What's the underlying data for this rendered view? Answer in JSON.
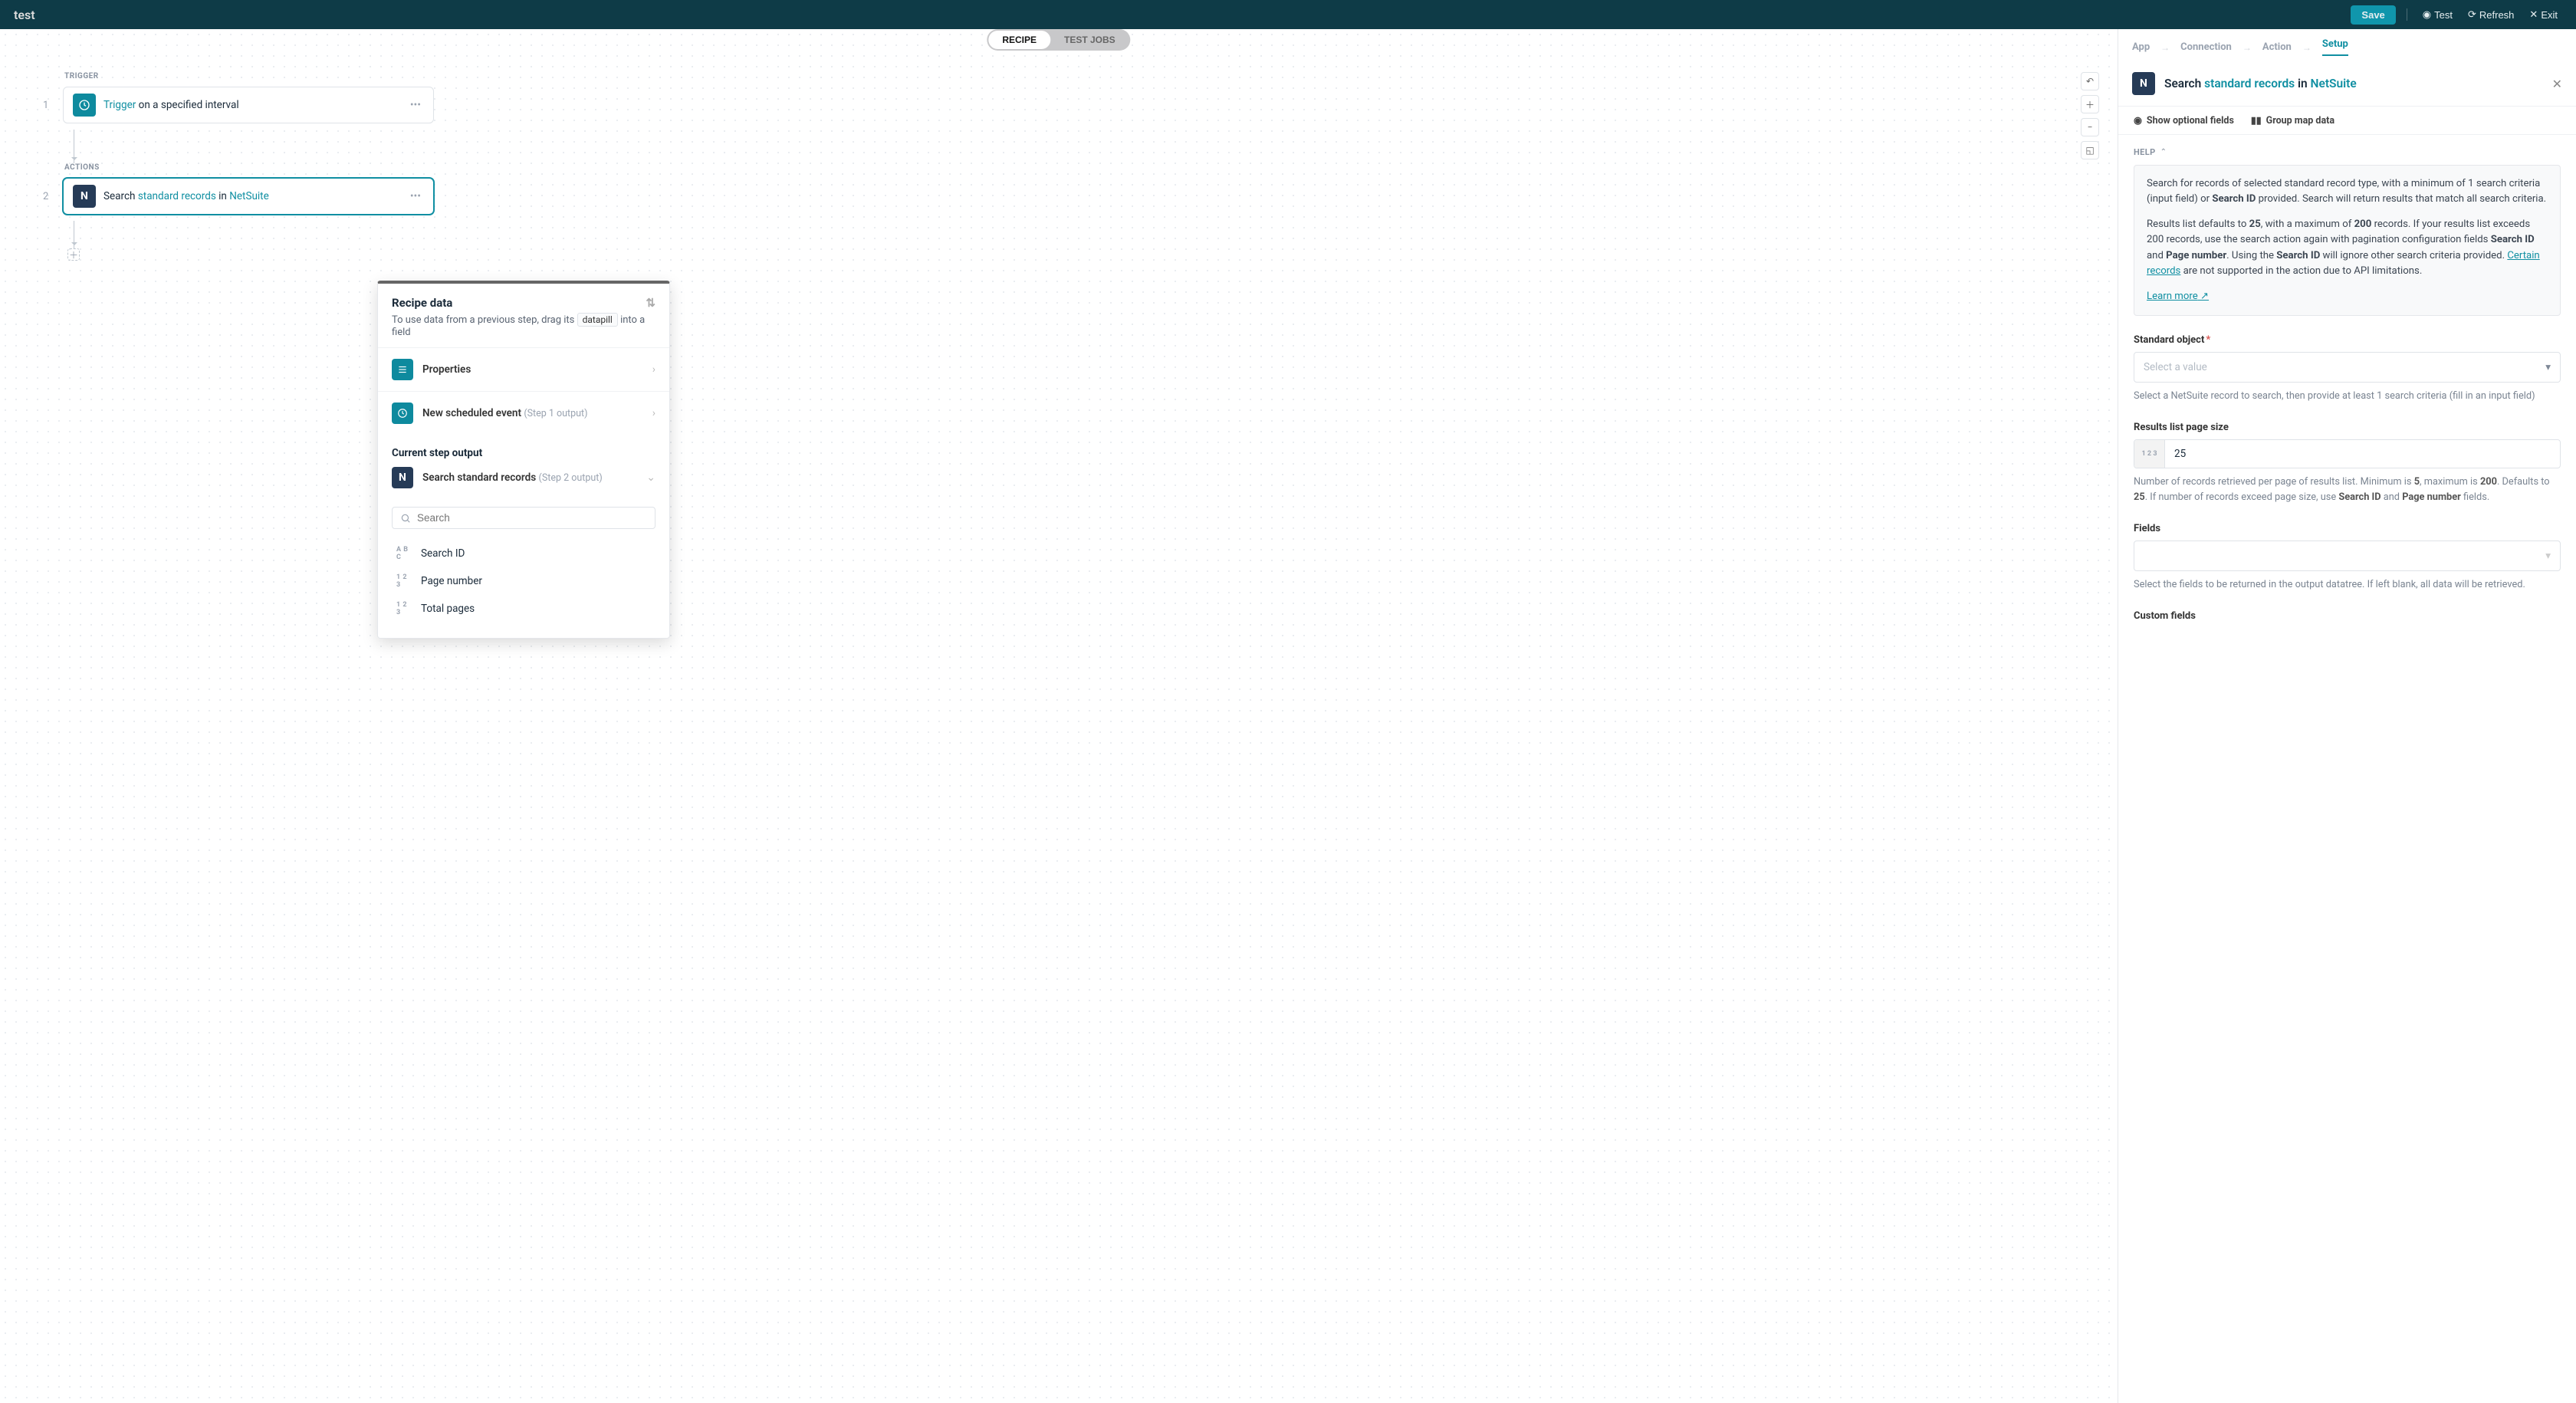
{
  "title": "test",
  "toolbar": {
    "save": "Save",
    "test": "Test",
    "refresh": "Refresh",
    "exit": "Exit"
  },
  "toggle": {
    "recipe": "RECIPE",
    "testJobs": "TEST JOBS"
  },
  "flow": {
    "trigger_label": "TRIGGER",
    "actions_label": "ACTIONS",
    "step1": {
      "num": "1",
      "prefix": "Trigger",
      "rest": " on a specified interval"
    },
    "step2": {
      "num": "2",
      "prefix": "Search ",
      "link1": "standard records",
      "mid": " in ",
      "link2": "NetSuite"
    }
  },
  "recipeData": {
    "title": "Recipe data",
    "sub_a": "To use data from a previous step, drag its ",
    "pill": "datapill",
    "sub_b": " into a field",
    "item1": "Properties",
    "item2": "New scheduled event",
    "item2_sub": "(Step 1 output)",
    "currentLabel": "Current step output",
    "item3": "Search standard records",
    "item3_sub": "(Step 2 output)",
    "searchPlaceholder": "Search",
    "pill1": {
      "type": "A B C",
      "label": "Search ID"
    },
    "pill2": {
      "type": "1 2 3",
      "label": "Page number"
    },
    "pill3": {
      "type": "1 2 3",
      "label": "Total pages"
    }
  },
  "panel": {
    "tabs": {
      "app": "App",
      "connection": "Connection",
      "action": "Action",
      "setup": "Setup"
    },
    "header": {
      "prefix": "Search ",
      "link1": "standard records",
      "mid": " in ",
      "link2": "NetSuite"
    },
    "actions": {
      "optional": "Show optional fields",
      "group": "Group map data"
    },
    "help": {
      "label": "HELP",
      "p1a": "Search for records of selected standard record type, with a minimum of 1 search criteria (input field) or ",
      "p1b": "Search ID",
      "p1c": " provided. Search will return results that match all search criteria.",
      "p2a": "Results list defaults to ",
      "p2b": "25",
      "p2c": ", with a maximum of ",
      "p2d": "200",
      "p2e": " records. If your results list exceeds 200 records, use the search action again with pagination configuration fields ",
      "p2f": "Search ID",
      "p2g": " and ",
      "p2h": "Page number",
      "p2i": ". Using the ",
      "p2j": "Search ID",
      "p2k": " will ignore other search criteria provided. ",
      "p2l": "Certain records",
      "p2m": " are not supported in the action due to API limitations.",
      "learn": "Learn more"
    },
    "fields": {
      "standard": {
        "label": "Standard object",
        "placeholder": "Select a value",
        "help": "Select a NetSuite record to search, then provide at least 1 search criteria (fill in an input field)"
      },
      "pagesize": {
        "label": "Results list page size",
        "value": "25",
        "help_a": "Number of records retrieved per page of results list. Minimum is ",
        "b5": "5",
        "help_b": ", maximum is ",
        "b200": "200",
        "help_c": ". Defaults to ",
        "b25": "25",
        "help_d": ". If number of records exceed page size, use ",
        "bSid": "Search ID",
        "help_e": " and ",
        "bPn": "Page number",
        "help_f": " fields."
      },
      "fieldsSel": {
        "label": "Fields",
        "help": "Select the fields to be returned in the output datatree. If left blank, all data will be retrieved."
      },
      "custom": {
        "label": "Custom fields"
      }
    }
  }
}
